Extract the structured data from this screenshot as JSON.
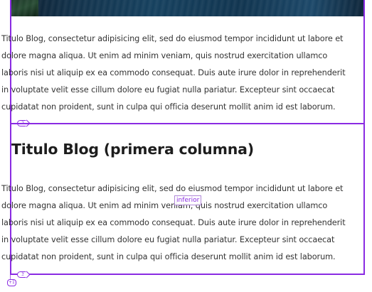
{
  "blog": {
    "block_1": {
      "paragraph": "Titulo Blog, consectetur adipisicing elit, sed do eiusmod tempor incididunt ut labore et dolore magna aliqua. Ut enim ad minim veniam, quis nostrud exercitation ullamco laboris nisi ut aliquip ex ea commodo consequat. Duis aute irure dolor in reprehenderit in voluptate velit esse cillum dolore eu fugiat nulla pariatur. Excepteur sint occaecat cupidatat non proident, sunt in culpa qui officia deserunt mollit anim id est laborum.",
      "handle_label": "2"
    },
    "block_2": {
      "heading": "Titulo Blog (primera columna)",
      "paragraph": "Titulo Blog, consectetur adipisicing elit, sed do eiusmod tempor incididunt ut labore et dolore magna aliqua. Ut enim ad minim veniam, quis nostrud exercitation ullamco laboris nisi ut aliquip ex ea commodo consequat. Duis aute irure dolor in reprehenderit in voluptate velit esse cillum dolore eu fugiat nulla pariatur. Excepteur sint occaecat cupidatat non proident, sunt in culpa qui officia deserunt mollit anim id est laborum.",
      "handle_label": "3"
    },
    "outer_handle_label": "+1"
  },
  "hover_label": "inferior",
  "colors": {
    "selection_accent": "#8a2be2",
    "text": "#333333",
    "heading": "#1d1d1d"
  },
  "icons": {
    "section_toggle": "chevron-right-icon",
    "hero": "sea-coast-image"
  }
}
